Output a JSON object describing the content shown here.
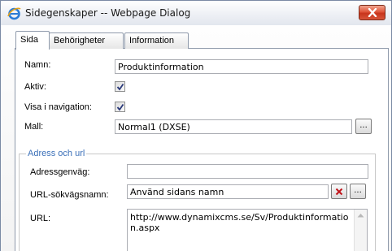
{
  "window": {
    "title": "Sidegenskaper -- Webpage Dialog"
  },
  "tabs": [
    {
      "label": "Sida",
      "active": true
    },
    {
      "label": "Behörigheter",
      "active": false
    },
    {
      "label": "Information",
      "active": false
    }
  ],
  "form": {
    "namn_label": "Namn:",
    "namn_value": "Produktinformation",
    "aktiv_label": "Aktiv:",
    "aktiv_checked": true,
    "visa_label": "Visa i navigation:",
    "visa_checked": true,
    "mall_label": "Mall:",
    "mall_value": "Normal1 (DXSE)",
    "browse_label": "..."
  },
  "address": {
    "legend": "Adress och url",
    "genvag_label": "Adressgenväg:",
    "genvag_value": "",
    "url_name_label": "URL-sökvägsnamn:",
    "url_name_value": "Använd sidans namn",
    "clear_label": "×",
    "url_name_browse_label": "...",
    "url_label": "URL:",
    "url_value": "http://www.dynamixcms.se/Sv/Produktinformation.aspx"
  },
  "colors": {
    "legend": "#3a6fb8",
    "close_button": "#d0402a",
    "clear_icon": "#c0141a"
  },
  "icons": {
    "app": "ie-icon",
    "close": "close-icon",
    "check": "checkmark-icon",
    "clear": "red-x-icon",
    "scroll_up": "scroll-up-arrow-icon"
  }
}
